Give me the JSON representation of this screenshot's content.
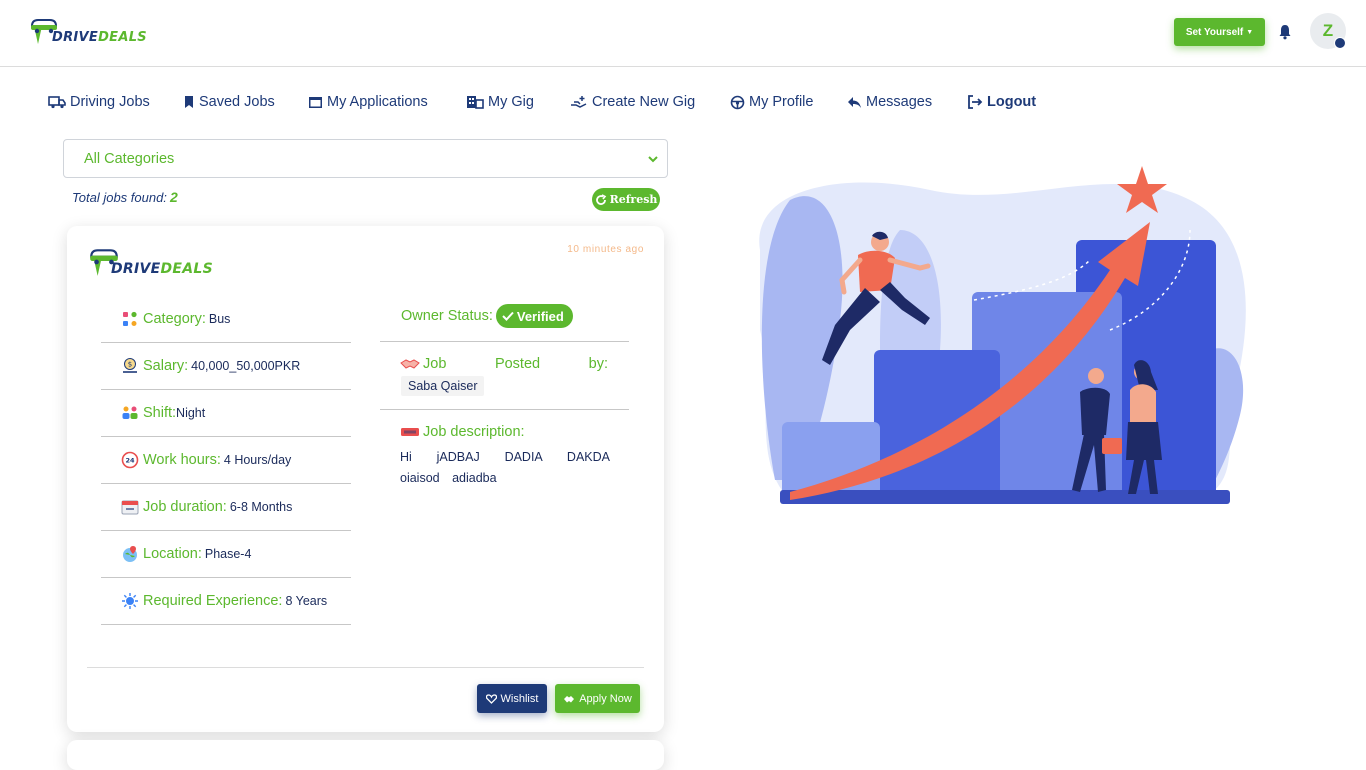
{
  "brand": {
    "drive": "DRIVE",
    "deals": "DEALS"
  },
  "header": {
    "set_yourself": "Set Yourself",
    "avatar_initial": "Z"
  },
  "nav": [
    {
      "label": "Driving Jobs",
      "icon": "truck-icon"
    },
    {
      "label": "Saved Jobs",
      "icon": "bookmark-icon"
    },
    {
      "label": "My Applications",
      "icon": "window-icon"
    },
    {
      "label": "My Gig",
      "icon": "building-icon"
    },
    {
      "label": "Create New Gig",
      "icon": "hand-plus-icon"
    },
    {
      "label": "My Profile",
      "icon": "steering-wheel-icon"
    },
    {
      "label": "Messages",
      "icon": "reply-icon"
    },
    {
      "label": "Logout",
      "icon": "logout-icon"
    }
  ],
  "filter": {
    "category_selected": "All Categories"
  },
  "results": {
    "total_label": "Total jobs found:",
    "total_count": "2",
    "refresh_label": "Refresh"
  },
  "job": {
    "posted_time": "10 minutes ago",
    "category": {
      "label": "Category:",
      "value": "Bus"
    },
    "salary": {
      "label": "Salary:",
      "value": "40,000_50,000PKR"
    },
    "shift": {
      "label": "Shift:",
      "value": "Night"
    },
    "work_hours": {
      "label": "Work hours:",
      "value": "4 Hours/day"
    },
    "duration": {
      "label": "Job duration:",
      "value": "6-8 Months"
    },
    "location": {
      "label": "Location:",
      "value": "Phase-4"
    },
    "experience": {
      "label": "Required Experience:",
      "value": "8 Years"
    },
    "owner_status": {
      "label": "Owner Status:",
      "value": "Verified"
    },
    "posted_by": {
      "label_job": "Job",
      "label_posted": "Posted",
      "label_by": "by:",
      "value": "Saba Qaiser"
    },
    "description": {
      "label": "Job description:",
      "value": "Hi jADBAJ DADIA DAKDA oiaisod adiadba"
    },
    "wishlist_label": "Wishlist",
    "apply_label": "Apply Now"
  },
  "colors": {
    "brand_green": "#5cb82e",
    "brand_navy": "#1e3a78",
    "accent_orange": "#f4b98a"
  }
}
